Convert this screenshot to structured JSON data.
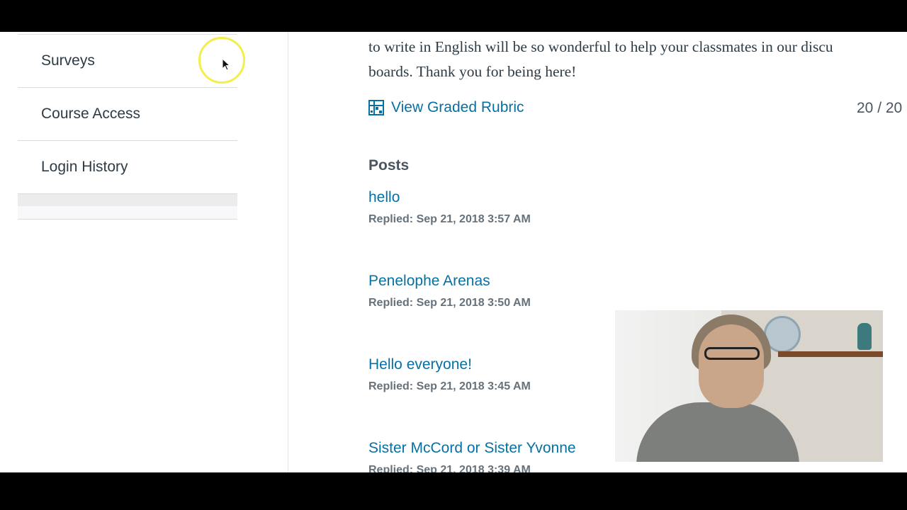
{
  "sidebar": {
    "items": [
      {
        "label": "Surveys"
      },
      {
        "label": "Course Access"
      },
      {
        "label": "Login History"
      }
    ]
  },
  "submission": {
    "comment_lines": [
      "to write in English will be so wonderful to help your classmates in our discu",
      "boards. Thank you for being here!"
    ],
    "rubric_link": "View Graded Rubric",
    "score": "20 / 20"
  },
  "posts": {
    "heading": "Posts",
    "items": [
      {
        "title": "hello",
        "date": "Replied: Sep 21, 2018 3:57 AM"
      },
      {
        "title": "Penelophe Arenas",
        "date": "Replied: Sep 21, 2018 3:50 AM"
      },
      {
        "title": "Hello everyone!",
        "date": "Replied: Sep 21, 2018 3:45 AM"
      },
      {
        "title": "Sister McCord or Sister Yvonne",
        "date": "Replied: Sep 21, 2018 3:39 AM"
      }
    ]
  },
  "colors": {
    "link": "#0770a3",
    "text": "#2d3b45",
    "muted": "#66717a",
    "cursor_highlight": "#f3ee4a"
  },
  "icons": {
    "rubric": "rubric-grid-icon",
    "cursor": "mouse-pointer-icon"
  }
}
